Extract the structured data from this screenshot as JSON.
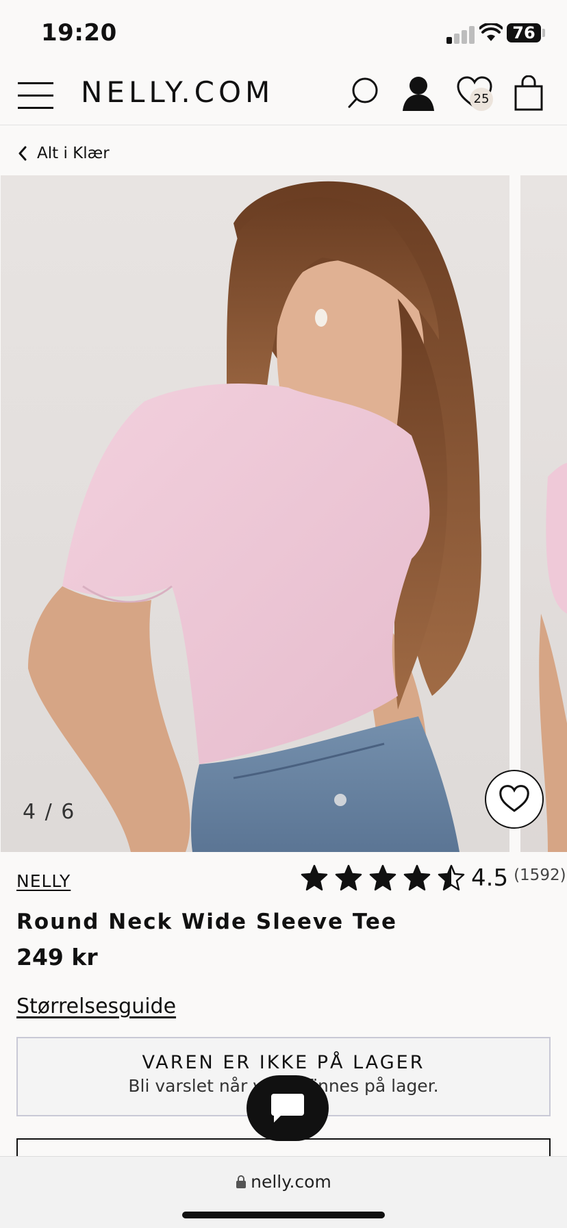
{
  "status_bar": {
    "time": "19:20",
    "battery": "76"
  },
  "header": {
    "logo": "NELLY.COM",
    "wishlist_count": "25"
  },
  "breadcrumb": {
    "label": "Alt i Klær"
  },
  "gallery": {
    "counter": "4 / 6"
  },
  "product": {
    "brand": "NELLY",
    "rating_value": "4.5",
    "rating_count": "(1592)",
    "rating_stars": 4.5,
    "title": "Round Neck Wide Sleeve Tee",
    "price": "249 kr",
    "size_guide": "Størrelsesguide",
    "stock_title": "VAREN ER IKKE PÅ LAGER",
    "stock_subtitle": "Bli varslet når varen finnes på lager."
  },
  "browser": {
    "url": "nelly.com"
  },
  "colors": {
    "shirt": "#efc9d8",
    "hair": "#7a4a2b",
    "jeans": "#5e7a9a",
    "accent": "#111111"
  }
}
